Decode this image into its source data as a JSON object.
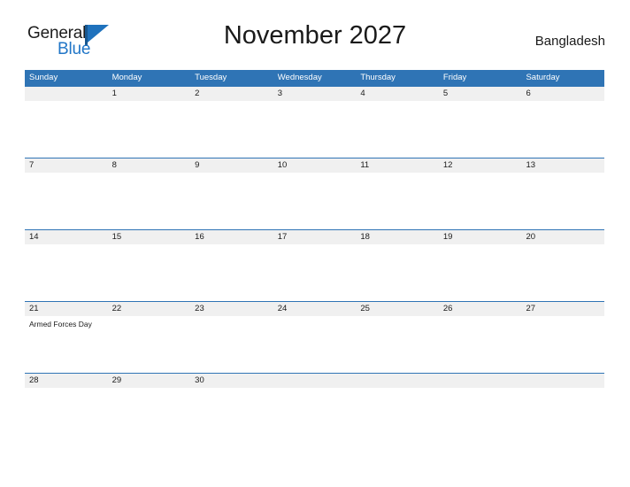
{
  "brand": {
    "name_top": "General",
    "name_bottom": "Blue",
    "mark": "flag-triangle-icon"
  },
  "header": {
    "title": "November 2027",
    "country": "Bangladesh"
  },
  "colors": {
    "header_blue": "#2f74b5",
    "band_gray": "#f0f0f0",
    "logo_blue": "#2176c7",
    "text": "#1a1a1a"
  },
  "calendar": {
    "weekdays": [
      "Sunday",
      "Monday",
      "Tuesday",
      "Wednesday",
      "Thursday",
      "Friday",
      "Saturday"
    ],
    "weeks": [
      {
        "days": [
          {
            "num": "",
            "events": []
          },
          {
            "num": "1",
            "events": []
          },
          {
            "num": "2",
            "events": []
          },
          {
            "num": "3",
            "events": []
          },
          {
            "num": "4",
            "events": []
          },
          {
            "num": "5",
            "events": []
          },
          {
            "num": "6",
            "events": []
          }
        ]
      },
      {
        "days": [
          {
            "num": "7",
            "events": []
          },
          {
            "num": "8",
            "events": []
          },
          {
            "num": "9",
            "events": []
          },
          {
            "num": "10",
            "events": []
          },
          {
            "num": "11",
            "events": []
          },
          {
            "num": "12",
            "events": []
          },
          {
            "num": "13",
            "events": []
          }
        ]
      },
      {
        "days": [
          {
            "num": "14",
            "events": []
          },
          {
            "num": "15",
            "events": []
          },
          {
            "num": "16",
            "events": []
          },
          {
            "num": "17",
            "events": []
          },
          {
            "num": "18",
            "events": []
          },
          {
            "num": "19",
            "events": []
          },
          {
            "num": "20",
            "events": []
          }
        ]
      },
      {
        "days": [
          {
            "num": "21",
            "events": [
              "Armed Forces Day"
            ]
          },
          {
            "num": "22",
            "events": []
          },
          {
            "num": "23",
            "events": []
          },
          {
            "num": "24",
            "events": []
          },
          {
            "num": "25",
            "events": []
          },
          {
            "num": "26",
            "events": []
          },
          {
            "num": "27",
            "events": []
          }
        ]
      },
      {
        "days": [
          {
            "num": "28",
            "events": []
          },
          {
            "num": "29",
            "events": []
          },
          {
            "num": "30",
            "events": []
          },
          {
            "num": "",
            "events": []
          },
          {
            "num": "",
            "events": []
          },
          {
            "num": "",
            "events": []
          },
          {
            "num": "",
            "events": []
          }
        ]
      }
    ]
  }
}
